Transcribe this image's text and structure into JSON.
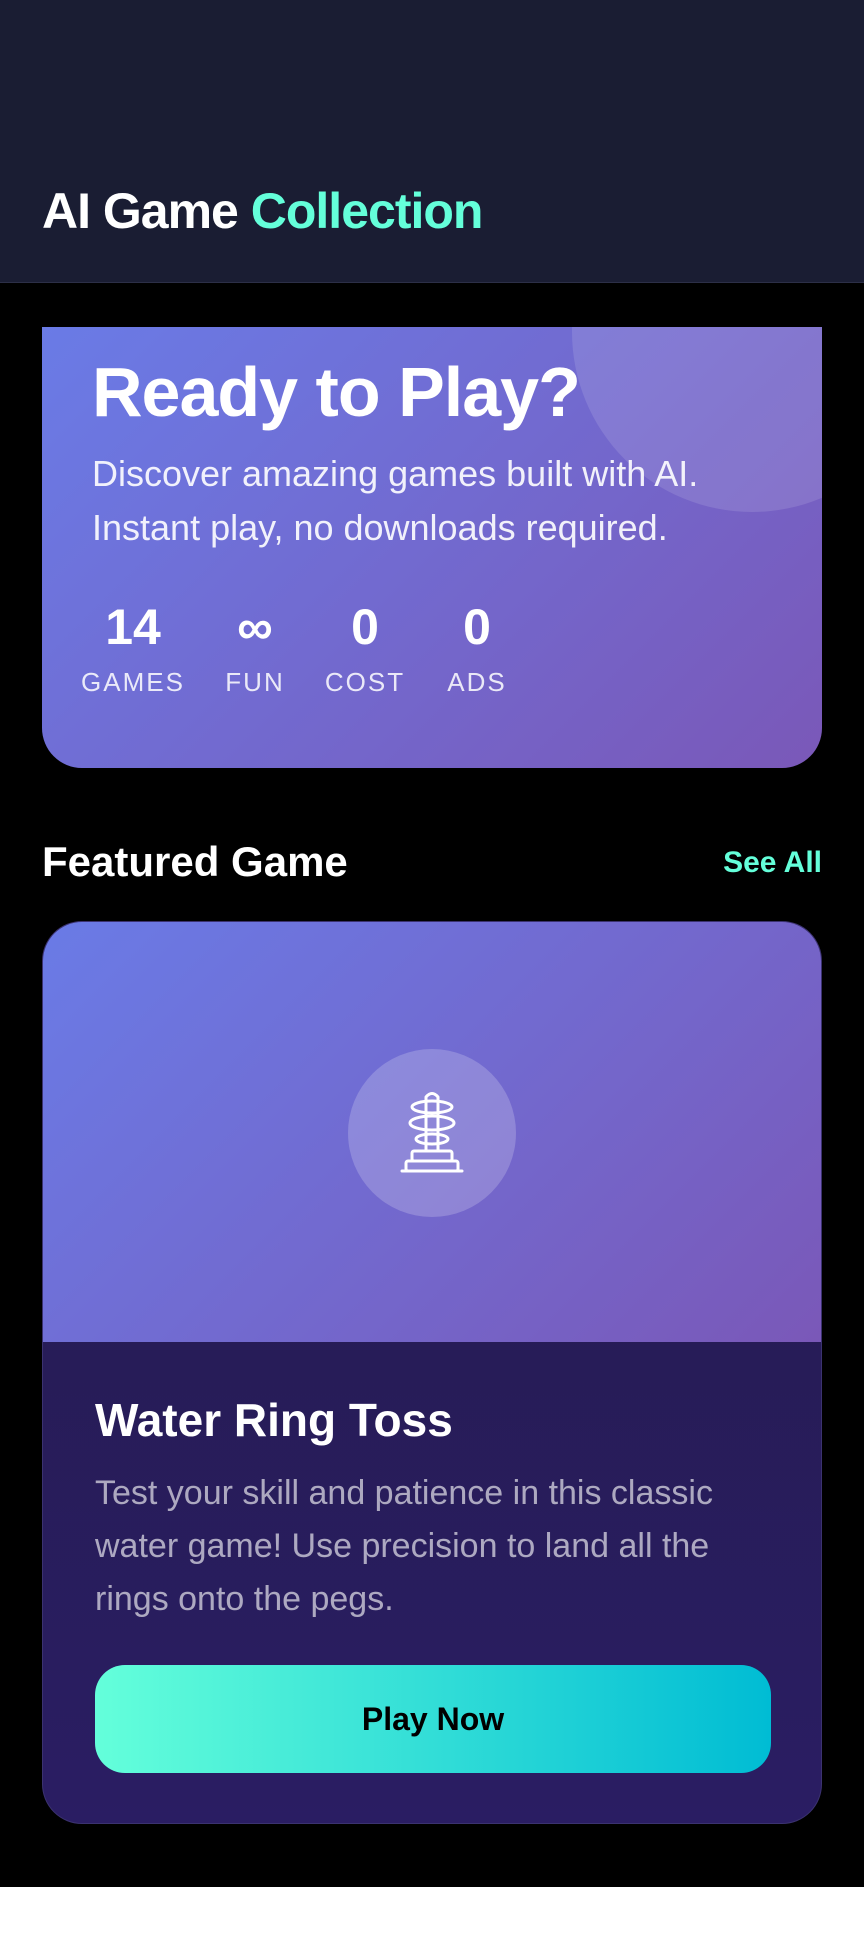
{
  "header": {
    "title_part1": "AI Game",
    "title_part2": "Collection",
    "accent_color": "#64ffda",
    "background": "#1a1d33"
  },
  "hero": {
    "title": "Ready to Play?",
    "description": "Discover amazing games built with AI. Instant play, no downloads required.",
    "stats": [
      {
        "value": "14",
        "label": "GAMES"
      },
      {
        "value": "∞",
        "label": "FUN"
      },
      {
        "value": "0",
        "label": "COST"
      },
      {
        "value": "0",
        "label": "ADS"
      }
    ]
  },
  "featured": {
    "section_title": "Featured Game",
    "see_all_label": "See All",
    "game": {
      "icon": "water-ring-toss-icon",
      "title": "Water Ring Toss",
      "description": "Test your skill and patience in this classic water game! Use precision to land all the rings onto the pegs.",
      "play_label": "Play Now"
    }
  }
}
